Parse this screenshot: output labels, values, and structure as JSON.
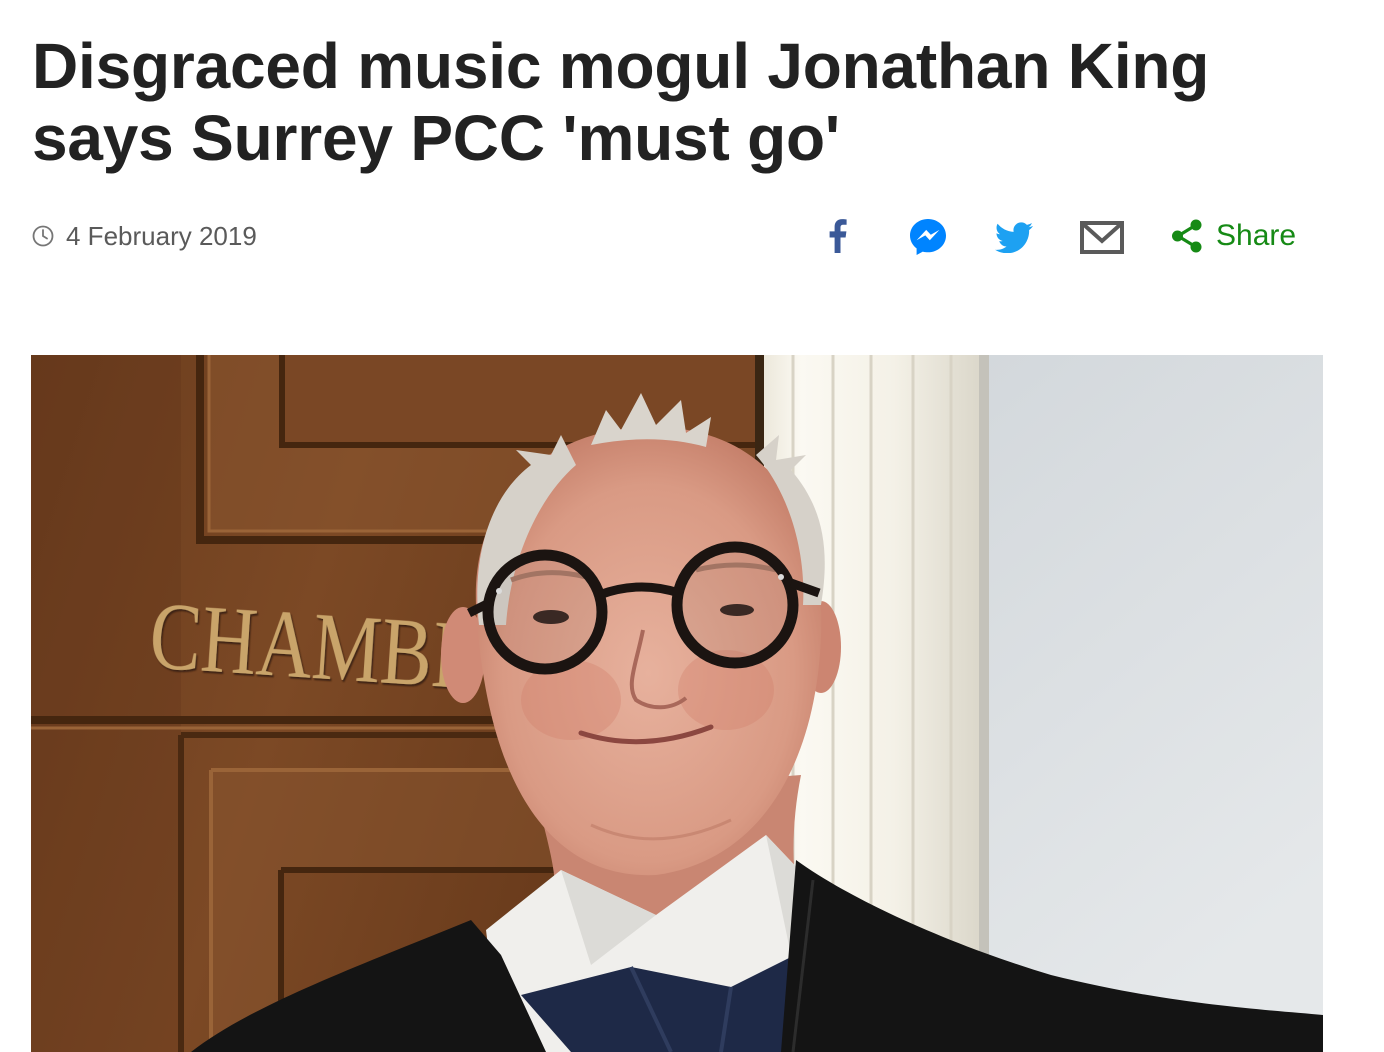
{
  "article": {
    "headline": "Disgraced music mogul Jonathan King says Surrey PCC 'must go'"
  },
  "meta": {
    "icon": "clock-icon",
    "date": "4 February 2019"
  },
  "share": {
    "facebook": {
      "icon": "facebook-icon",
      "color": "#3b5998"
    },
    "messenger": {
      "icon": "messenger-icon",
      "color": "#0084ff"
    },
    "twitter": {
      "icon": "twitter-icon",
      "color": "#1da1f2"
    },
    "email": {
      "icon": "email-icon",
      "color": "#5a5a5a"
    },
    "share_button": {
      "icon": "share-icon",
      "label": "Share",
      "color": "#168a15"
    }
  },
  "photo": {
    "sign_text": "CHAMBE"
  },
  "colors": {
    "headline": "#222222",
    "meta_text": "#5a5a5a"
  }
}
